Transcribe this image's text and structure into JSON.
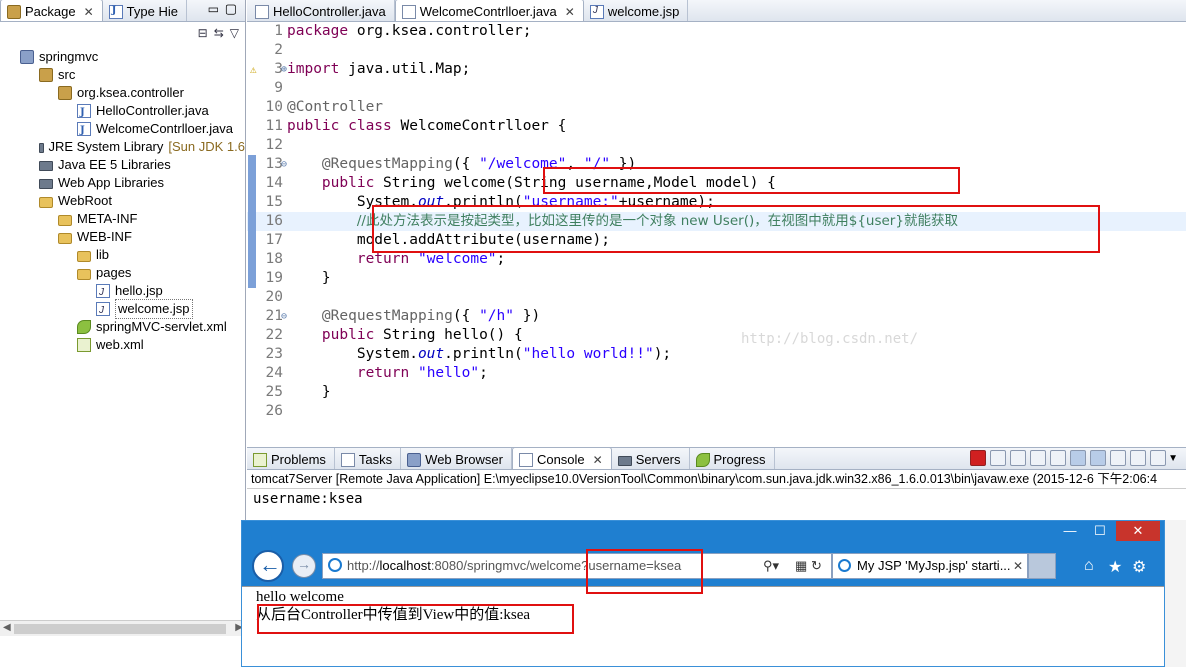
{
  "explorer": {
    "tabs": [
      {
        "label": "Package",
        "active": true
      },
      {
        "label": "Type Hie",
        "active": false
      }
    ],
    "tree": [
      {
        "label": "springmvc",
        "depth": 0,
        "icon": "project-icon"
      },
      {
        "label": "src",
        "depth": 1,
        "icon": "source-folder-icon"
      },
      {
        "label": "org.ksea.controller",
        "depth": 2,
        "icon": "package-icon"
      },
      {
        "label": "HelloController.java",
        "depth": 3,
        "icon": "java-file-icon"
      },
      {
        "label": "WelcomeContrlloer.java",
        "depth": 3,
        "icon": "java-file-icon"
      },
      {
        "label": "JRE System Library",
        "suffix": "[Sun JDK 1.6",
        "depth": 1,
        "icon": "library-icon"
      },
      {
        "label": "Java EE 5 Libraries",
        "depth": 1,
        "icon": "library-icon"
      },
      {
        "label": "Web App Libraries",
        "depth": 1,
        "icon": "library-icon"
      },
      {
        "label": "WebRoot",
        "depth": 1,
        "icon": "folder-icon"
      },
      {
        "label": "META-INF",
        "depth": 2,
        "icon": "folder-icon"
      },
      {
        "label": "WEB-INF",
        "depth": 2,
        "icon": "folder-icon"
      },
      {
        "label": "lib",
        "depth": 3,
        "icon": "folder-icon"
      },
      {
        "label": "pages",
        "depth": 3,
        "icon": "folder-icon"
      },
      {
        "label": "hello.jsp",
        "depth": 4,
        "icon": "jsp-file-icon"
      },
      {
        "label": "welcome.jsp",
        "depth": 4,
        "icon": "jsp-file-icon",
        "selected": true
      },
      {
        "label": "springMVC-servlet.xml",
        "depth": 3,
        "icon": "spring-xml-icon"
      },
      {
        "label": "web.xml",
        "depth": 3,
        "icon": "xml-file-icon"
      }
    ]
  },
  "editor": {
    "tabs": [
      {
        "label": "HelloController.java",
        "active": false
      },
      {
        "label": "WelcomeContrlloer.java",
        "active": true
      },
      {
        "label": "welcome.jsp",
        "active": false
      }
    ],
    "lines": [
      {
        "n": "1",
        "code": [
          [
            "kw",
            "package"
          ],
          [
            "",
            "org.ksea.controller;"
          ]
        ]
      },
      {
        "n": "2",
        "code": []
      },
      {
        "n": "3",
        "code": [
          [
            "kw",
            "import"
          ],
          [
            "",
            "java.util.Map;"
          ]
        ],
        "fold": "+",
        "warn": true
      },
      {
        "n": "9",
        "code": []
      },
      {
        "n": "10",
        "code": [
          [
            "ann",
            "@Controller"
          ]
        ]
      },
      {
        "n": "11",
        "code": [
          [
            "kw",
            "public class"
          ],
          [
            "",
            "WelcomeContrlloer {"
          ]
        ]
      },
      {
        "n": "12",
        "code": []
      },
      {
        "n": "13",
        "code": [
          [
            "",
            "    "
          ],
          [
            "ann",
            "@RequestMapping"
          ],
          [
            "",
            "({ "
          ],
          [
            "str",
            "\"/welcome\""
          ],
          [
            "",
            ", "
          ],
          [
            "str",
            "\"/\""
          ],
          [
            "",
            " })"
          ]
        ],
        "fold": "-"
      },
      {
        "n": "14",
        "code": [
          [
            "",
            "    "
          ],
          [
            "kw",
            "public"
          ],
          [
            "",
            "String welcome(String username,Model model) {"
          ]
        ]
      },
      {
        "n": "15",
        "code": [
          [
            "",
            "        System."
          ],
          [
            "fld",
            "out"
          ],
          [
            "",
            ".println("
          ],
          [
            "str",
            "\"username:\""
          ],
          [
            "",
            "+username);"
          ]
        ]
      },
      {
        "n": "16",
        "code": [
          [
            "",
            "        "
          ],
          [
            "cmt",
            "//此处方法表示是按起类型，比如这里传的是一个对象 new User()，在视图中就用${user}就能获取"
          ]
        ],
        "highlight": true
      },
      {
        "n": "17",
        "code": [
          [
            "",
            "        model.addAttribute(username);"
          ]
        ]
      },
      {
        "n": "18",
        "code": [
          [
            "",
            "        "
          ],
          [
            "kw",
            "return"
          ],
          [
            "str",
            "\"welcome\""
          ],
          [
            "",
            ";"
          ]
        ]
      },
      {
        "n": "19",
        "code": [
          [
            "",
            "    }"
          ]
        ]
      },
      {
        "n": "20",
        "code": []
      },
      {
        "n": "21",
        "code": [
          [
            "",
            "    "
          ],
          [
            "ann",
            "@RequestMapping"
          ],
          [
            "",
            "({ "
          ],
          [
            "str",
            "\"/h\""
          ],
          [
            "",
            " })"
          ]
        ],
        "fold": "-"
      },
      {
        "n": "22",
        "code": [
          [
            "",
            "    "
          ],
          [
            "kw",
            "public"
          ],
          [
            "",
            "String hello() {"
          ]
        ]
      },
      {
        "n": "23",
        "code": [
          [
            "",
            "        System."
          ],
          [
            "fld",
            "out"
          ],
          [
            "",
            ".println("
          ],
          [
            "str",
            "\"hello world!!\""
          ],
          [
            "",
            ");"
          ]
        ]
      },
      {
        "n": "24",
        "code": [
          [
            "",
            "        "
          ],
          [
            "kw",
            "return"
          ],
          [
            "str",
            "\"hello\""
          ],
          [
            "",
            ";"
          ]
        ]
      },
      {
        "n": "25",
        "code": [
          [
            "",
            "    }"
          ]
        ]
      },
      {
        "n": "26",
        "code": []
      }
    ],
    "watermark": "http://blog.csdn.net/"
  },
  "console": {
    "tabs": [
      {
        "label": "Problems",
        "active": false
      },
      {
        "label": "Tasks",
        "active": false
      },
      {
        "label": "Web Browser",
        "active": false
      },
      {
        "label": "Console",
        "active": true
      },
      {
        "label": "Servers",
        "active": false
      },
      {
        "label": "Progress",
        "active": false
      }
    ],
    "header": "tomcat7Server [Remote Java Application] E:\\myeclipse10.0VersionTool\\Common\\binary\\com.sun.java.jdk.win32.x86_1.6.0.013\\bin\\javaw.exe (2015-12-6 下午2:06:4",
    "output": "username:ksea"
  },
  "browser": {
    "url_prefix": "http://",
    "url_host": "localhost",
    "url_rest": ":8080/springmvc/welcome?username=ksea",
    "tab_title": "My JSP 'MyJsp.jsp' starti...",
    "page_line1": "hello welcome",
    "page_line2": "从后台Controller中传值到View中的值:ksea"
  }
}
